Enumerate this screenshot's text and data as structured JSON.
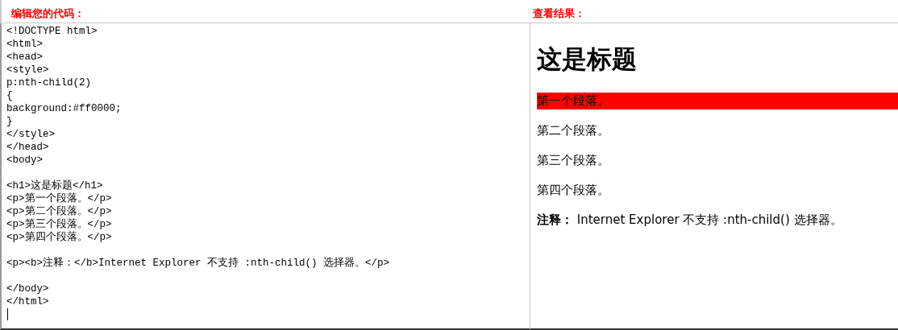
{
  "editor": {
    "label": "编辑您的代码：",
    "code_blocks": [
      [
        "<!DOCTYPE html>",
        "<html>",
        "<head>",
        "<style>",
        "p:nth-child(2)",
        "{",
        "background:#ff0000;",
        "}",
        "</style>",
        "</head>",
        "<body>"
      ],
      [
        "<h1>这是标题</h1>",
        "<p>第一个段落。</p>",
        "<p>第二个段落。</p>",
        "<p>第三个段落。</p>",
        "<p>第四个段落。</p>"
      ],
      [
        "<p><b>注释：</b>Internet Explorer 不支持 :nth-child() 选择器。</p>"
      ],
      [
        "</body>",
        "</html>"
      ]
    ]
  },
  "result": {
    "label": "查看结果：",
    "heading": "这是标题",
    "paragraphs": [
      {
        "text": "第一个段落。",
        "highlighted": true
      },
      {
        "text": "第二个段落。",
        "highlighted": false
      },
      {
        "text": "第三个段落。",
        "highlighted": false
      },
      {
        "text": "第四个段落。",
        "highlighted": false
      },
      {
        "text": "**注释：** Internet Explorer 不支持 :nth-child() 选择器。",
        "highlighted": false
      }
    ]
  }
}
